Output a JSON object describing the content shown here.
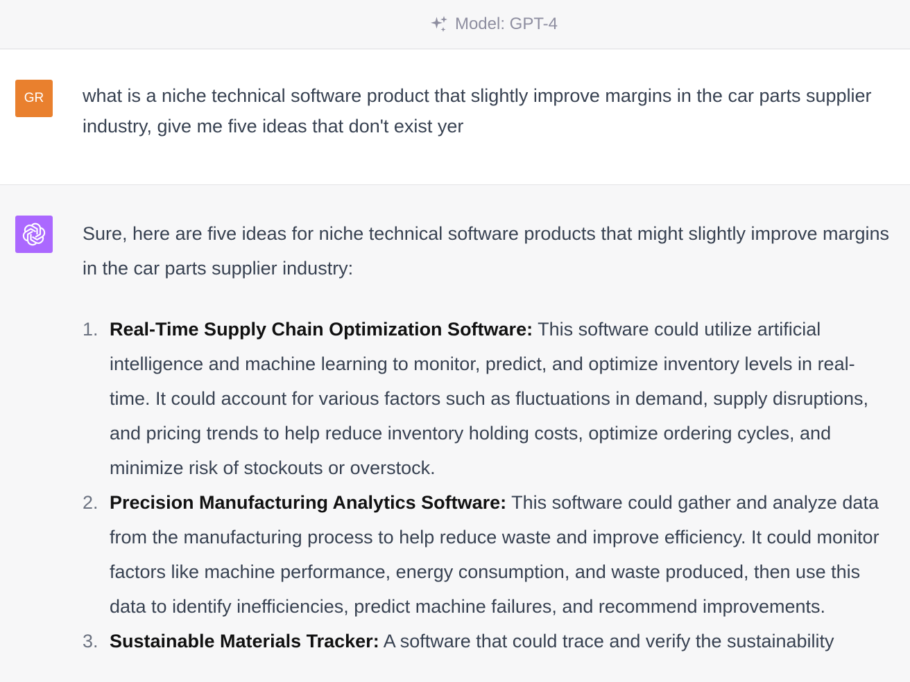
{
  "header": {
    "sparkle_icon": "sparkle-icon",
    "model_label": "Model: GPT-4"
  },
  "user_message": {
    "avatar_initials": "GR",
    "avatar_color": "#e9802e",
    "text": "what is a niche technical software product that slightly improve margins in the car parts supplier industry, give me five ideas that don't exist yer"
  },
  "assistant_message": {
    "avatar_icon": "openai-logo-icon",
    "avatar_color": "#ab68ff",
    "intro": "Sure, here are five ideas for niche technical software products that might slightly improve margins in the car parts supplier industry:",
    "items": [
      {
        "number": "1.",
        "name": "Real-Time Supply Chain Optimization Software:",
        "description": " This software could utilize artificial intelligence and machine learning to monitor, predict, and optimize inventory levels in real-time. It could account for various factors such as fluctuations in demand, supply disruptions, and pricing trends to help reduce inventory holding costs, optimize ordering cycles, and minimize risk of stockouts or overstock."
      },
      {
        "number": "2.",
        "name": "Precision Manufacturing Analytics Software:",
        "description": " This software could gather and analyze data from the manufacturing process to help reduce waste and improve efficiency. It could monitor factors like machine performance, energy consumption, and waste produced, then use this data to identify inefficiencies, predict machine failures, and recommend improvements."
      },
      {
        "number": "3.",
        "name": "Sustainable Materials Tracker:",
        "description": " A software that could trace and verify the sustainability"
      }
    ]
  }
}
